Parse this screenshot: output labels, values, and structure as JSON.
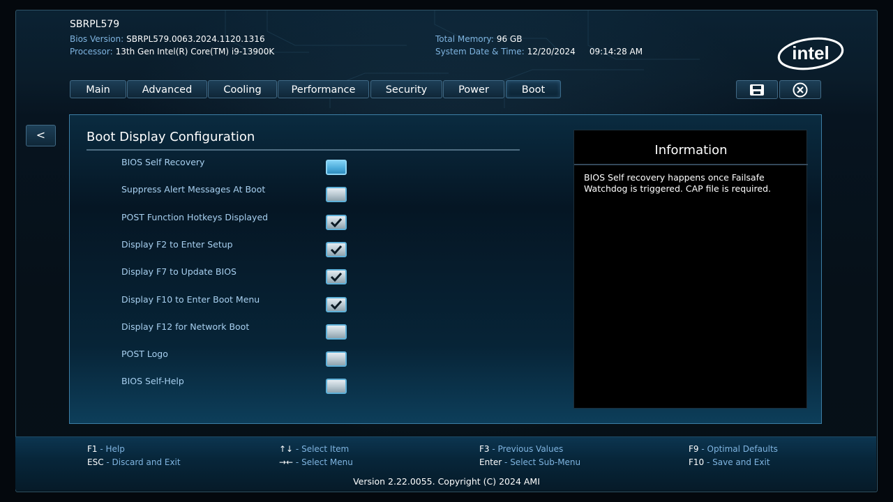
{
  "header": {
    "model": "SBRPL579",
    "bios_version_label": "Bios Version:",
    "bios_version": "SBRPL579.0063.2024.1120.1316",
    "processor_label": "Processor:",
    "processor": "13th Gen Intel(R) Core(TM) i9-13900K",
    "memory_label": "Total Memory:",
    "memory": "96 GB",
    "datetime_label": "System Date & Time:",
    "date": "12/20/2024",
    "time": "09:14:28 AM",
    "logo_text": "intel"
  },
  "tabs": [
    {
      "label": "Main"
    },
    {
      "label": "Advanced"
    },
    {
      "label": "Cooling"
    },
    {
      "label": "Performance"
    },
    {
      "label": "Security"
    },
    {
      "label": "Power"
    },
    {
      "label": "Boot",
      "active": true
    }
  ],
  "toolbar": {
    "save_icon": "floppy-disk-icon",
    "exit_icon": "close-circle-icon",
    "back_label": "<"
  },
  "page": {
    "title": "Boot Display Configuration",
    "options": [
      {
        "label": "BIOS Self Recovery",
        "checked": false,
        "focused": true
      },
      {
        "label": "Suppress Alert Messages At Boot",
        "checked": false
      },
      {
        "label": "POST Function Hotkeys Displayed",
        "checked": true
      },
      {
        "label": "Display F2 to Enter Setup",
        "checked": true
      },
      {
        "label": "Display F7 to Update BIOS",
        "checked": true
      },
      {
        "label": "Display F10 to Enter Boot Menu",
        "checked": true
      },
      {
        "label": "Display F12 for Network Boot",
        "checked": false
      },
      {
        "label": "POST Logo",
        "checked": false
      },
      {
        "label": "BIOS Self-Help",
        "checked": false
      }
    ]
  },
  "information": {
    "title": "Information",
    "text": "BIOS Self recovery happens once Failsafe Watchdog is triggered. CAP file is required."
  },
  "footer": {
    "keys": [
      {
        "key": "F1",
        "desc": "Help"
      },
      {
        "key": "ESC",
        "desc": "Discard and Exit"
      },
      {
        "key": "↑↓",
        "desc": "Select Item"
      },
      {
        "key": "→←",
        "desc": "Select Menu"
      },
      {
        "key": "F3",
        "desc": "Previous Values"
      },
      {
        "key": "Enter",
        "desc": "Select Sub-Menu"
      },
      {
        "key": "F9",
        "desc": "Optimal Defaults"
      },
      {
        "key": "F10",
        "desc": "Save and Exit"
      }
    ],
    "separator": " - ",
    "version": "Version 2.22.0055. Copyright (C) 2024 AMI"
  },
  "colors": {
    "accent": "#7fb4e0",
    "option_text": "#a8d0f0",
    "panel_border": "#3d7fa6",
    "background": "#061017"
  }
}
